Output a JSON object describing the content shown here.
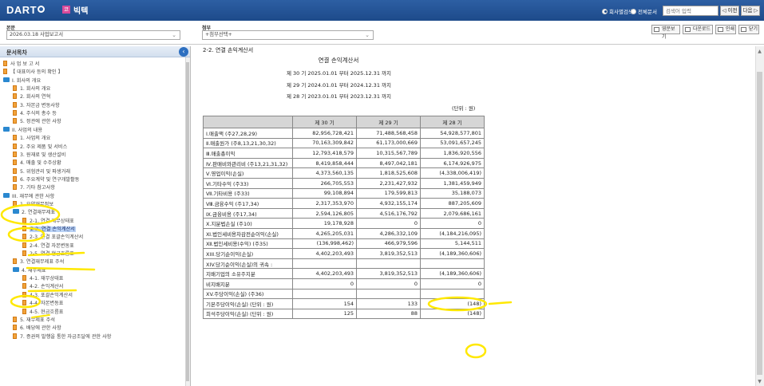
{
  "header": {
    "logo_text": "DART",
    "company_badge": "코",
    "company_name": "빅텍",
    "radio_company": "회사별검색",
    "radio_all": "전체문서",
    "search_placeholder": "검색어 입력",
    "prev_label": "◁ 이전",
    "next_label": "다음 ▷"
  },
  "selectors": {
    "main_label": "본문",
    "main_value": "2026.03.18  사업보고서",
    "attach_label": "첨부",
    "attach_value": "+첨부선택+",
    "btn_english": "영문보기",
    "btn_download": "다운로드",
    "btn_print": "인쇄",
    "btn_close": "닫기"
  },
  "toc": {
    "title": "문서목차",
    "items": [
      {
        "label": "사 업 보 고 서",
        "indent": 0,
        "type": "doc"
      },
      {
        "label": "【 대표이사 등의 확인 】",
        "indent": 0,
        "type": "doc"
      },
      {
        "label": "I. 회사의 개요",
        "indent": 0,
        "type": "folder"
      },
      {
        "label": "1. 회사의 개요",
        "indent": 1,
        "type": "doc"
      },
      {
        "label": "2. 회사의 연혁",
        "indent": 1,
        "type": "doc"
      },
      {
        "label": "3. 자본금 변동사항",
        "indent": 1,
        "type": "doc"
      },
      {
        "label": "4. 주식의 총수 등",
        "indent": 1,
        "type": "doc"
      },
      {
        "label": "5. 정관에 관한 사항",
        "indent": 1,
        "type": "doc"
      },
      {
        "label": "II. 사업의 내용",
        "indent": 0,
        "type": "folder"
      },
      {
        "label": "1. 사업의 개요",
        "indent": 1,
        "type": "doc"
      },
      {
        "label": "2. 주요 제품 및 서비스",
        "indent": 1,
        "type": "doc"
      },
      {
        "label": "3. 원재료 및 생산설비",
        "indent": 1,
        "type": "doc"
      },
      {
        "label": "4. 매출 및 수주상황",
        "indent": 1,
        "type": "doc"
      },
      {
        "label": "5. 위험관리 및 파생거래",
        "indent": 1,
        "type": "doc"
      },
      {
        "label": "6. 주요계약 및 연구개발활동",
        "indent": 1,
        "type": "doc"
      },
      {
        "label": "7. 기타 참고사항",
        "indent": 1,
        "type": "doc"
      },
      {
        "label": "III. 재무에 관한 사항",
        "indent": 0,
        "type": "folder"
      },
      {
        "label": "1. 요약재무정보",
        "indent": 1,
        "type": "doc"
      },
      {
        "label": "2. 연결재무제표",
        "indent": 1,
        "type": "folder"
      },
      {
        "label": "2-1. 연결 재무상태표",
        "indent": 2,
        "type": "doc"
      },
      {
        "label": "2-2. 연결 손익계산서",
        "indent": 2,
        "type": "doc",
        "selected": true
      },
      {
        "label": "2-3. 연결 포괄손익계산서",
        "indent": 2,
        "type": "doc"
      },
      {
        "label": "2-4. 연결 자본변동표",
        "indent": 2,
        "type": "doc"
      },
      {
        "label": "2-5. 연결 현금흐름표",
        "indent": 2,
        "type": "doc"
      },
      {
        "label": "3. 연결재무제표 주석",
        "indent": 1,
        "type": "doc"
      },
      {
        "label": "4. 재무제표",
        "indent": 1,
        "type": "folder"
      },
      {
        "label": "4-1. 재무상태표",
        "indent": 2,
        "type": "doc"
      },
      {
        "label": "4-2. 손익계산서",
        "indent": 2,
        "type": "doc"
      },
      {
        "label": "4-3. 포괄손익계산서",
        "indent": 2,
        "type": "doc"
      },
      {
        "label": "4-4. 자본변동표",
        "indent": 2,
        "type": "doc"
      },
      {
        "label": "4-5. 현금흐름표",
        "indent": 2,
        "type": "doc"
      },
      {
        "label": "5. 재무제표 주석",
        "indent": 1,
        "type": "doc"
      },
      {
        "label": "6. 배당에 관한 사항",
        "indent": 1,
        "type": "doc"
      },
      {
        "label": "7. 증권의 발행을 통한 자금조달에 관한 사항",
        "indent": 1,
        "type": "doc"
      }
    ]
  },
  "document": {
    "section_title": "2-2. 연결 손익계산서",
    "title": "연결 손익계산서",
    "periods": [
      "제 30 기 2025.01.01 부터 2025.12.31 까지",
      "제 29 기 2024.01.01 부터 2024.12.31 까지",
      "제 28 기 2023.01.01 부터 2023.12.31 까지"
    ],
    "unit": "(단위 : 원)",
    "columns": [
      "",
      "제 30 기",
      "제 29 기",
      "제 28 기"
    ],
    "rows": [
      [
        "Ⅰ.매출액 (주27,28,29)",
        "82,956,728,421",
        "71,488,568,458",
        "54,928,577,801"
      ],
      [
        "Ⅱ.매출원가 (주8,13,21,30,32)",
        "70,163,309,842",
        "61,173,000,669",
        "53,091,657,245"
      ],
      [
        "Ⅲ.매출총이익",
        "12,793,418,579",
        "10,315,567,789",
        "1,836,920,556"
      ],
      [
        "Ⅳ.판매비와관리비 (주13,21,31,32)",
        "8,419,858,444",
        "8,497,042,181",
        "6,174,926,975"
      ],
      [
        "Ⅴ.영업이익(손실)",
        "4,373,560,135",
        "1,818,525,608",
        "(4,338,006,419)"
      ],
      [
        "Ⅵ.기타수익 (주33)",
        "266,705,553",
        "2,231,427,932",
        "1,381,459,949"
      ],
      [
        "Ⅶ.기타비용 (주33)",
        "99,108,894",
        "179,599,813",
        "35,188,073"
      ],
      [
        "Ⅷ.금융수익 (주17,34)",
        "2,317,353,970",
        "4,932,155,174",
        "887,205,609"
      ],
      [
        "Ⅸ.금융비용 (주17,34)",
        "2,594,126,805",
        "4,516,176,792",
        "2,079,686,161"
      ],
      [
        "Ⅹ.지분법손실 (주10)",
        "19,178,928",
        "0",
        "0"
      ],
      [
        "Ⅺ.법인세비용차감전순이익(손실)",
        "4,265,205,031",
        "4,286,332,109",
        "(4,184,216,095)"
      ],
      [
        "Ⅻ.법인세비용(수익) (주35)",
        "(136,998,462)",
        "466,979,596",
        "5,144,511"
      ],
      [
        "XIII.당기순이익(손실)",
        "4,402,203,493",
        "3,819,352,513",
        "(4,189,360,606)"
      ],
      [
        "XIV.당기순이익(손실)의 귀속 :",
        "",
        "",
        ""
      ],
      [
        "  지배기업의 소유주지분",
        "4,402,203,493",
        "3,819,352,513",
        "(4,189,360,606)"
      ],
      [
        "  비지배지분",
        "0",
        "0",
        "0"
      ],
      [
        "XV.주당이익(손실) (주36)",
        "",
        "",
        ""
      ],
      [
        "  기본주당이익(손실) (단위 : 원)",
        "154",
        "133",
        "(148)"
      ],
      [
        "  희석주당이익(손실) (단위 : 원)",
        "125",
        "88",
        "(148)"
      ]
    ]
  },
  "colors": {
    "header_bg": "#1d4a8a",
    "highlight": "#ffe800",
    "selected_bg": "#b9d2f5"
  }
}
